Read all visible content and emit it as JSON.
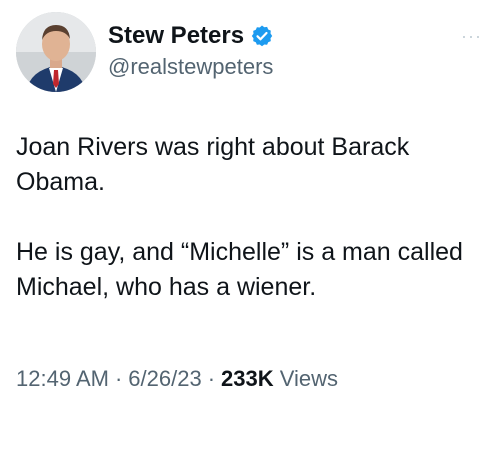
{
  "author": {
    "display_name": "Stew Peters",
    "handle": "@realstewpeters",
    "verified": true,
    "verified_color": "#1d9bf0"
  },
  "tweet": {
    "paragraphs": [
      "Joan Rivers was right about Barack Obama.",
      "He is gay, and “Michelle” is a man called Michael, who has a wiener."
    ]
  },
  "meta": {
    "time": "12:49 AM",
    "date": "6/26/23",
    "separator": "·",
    "views_count": "233K",
    "views_label": "Views"
  },
  "more_icon": "more-dots-icon"
}
